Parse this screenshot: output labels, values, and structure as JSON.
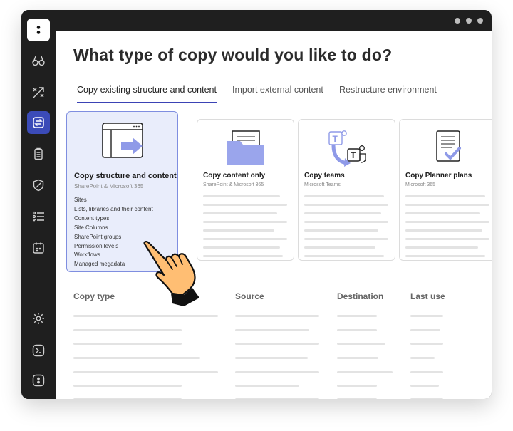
{
  "page": {
    "title": "What type of copy would you like to do?"
  },
  "tabs": [
    {
      "label": "Copy existing structure and content",
      "active": true
    },
    {
      "label": "Import external content",
      "active": false
    },
    {
      "label": "Restructure environment",
      "active": false
    }
  ],
  "sidebar": {
    "items": [
      {
        "icon": "app-logo-icon"
      },
      {
        "icon": "binoculars-icon"
      },
      {
        "icon": "migration-arrows-icon"
      },
      {
        "icon": "copy-swap-icon",
        "active": true
      },
      {
        "icon": "clipboard-icon"
      },
      {
        "icon": "shield-icon"
      },
      {
        "icon": "checklist-icon"
      },
      {
        "icon": "calendar-icon"
      },
      {
        "icon": "gear-icon"
      },
      {
        "icon": "terminal-icon"
      },
      {
        "icon": "app-badge-icon"
      }
    ]
  },
  "cards": [
    {
      "title": "Copy structure and content",
      "subtitle": "SharePoint & Microsoft 365",
      "icon": "window-arrow-icon",
      "selected": true,
      "features": [
        "Sites",
        "Lists, libraries and their content",
        "Content types",
        "Site Columns",
        "SharePoint groups",
        "Permission levels",
        "Workflows",
        "Managed megadata"
      ]
    },
    {
      "title": "Copy content only",
      "subtitle": "SharePoint & Microsoft 365",
      "icon": "folder-icon",
      "selected": false
    },
    {
      "title": "Copy teams",
      "subtitle": "Microsoft Teams",
      "icon": "teams-icon",
      "selected": false
    },
    {
      "title": "Copy Planner plans",
      "subtitle": "Microsoft 365",
      "icon": "planner-icon",
      "selected": false
    }
  ],
  "table": {
    "headers": [
      "Copy type",
      "Source",
      "Destination",
      "Last use"
    ]
  },
  "colors": {
    "accent": "#3b43b5",
    "sidebar": "#1f1f1f",
    "selected_card": "#e9edfb",
    "icon_fill": "#9aa5ec"
  },
  "cursor": {
    "icon": "pointing-hand-icon"
  }
}
